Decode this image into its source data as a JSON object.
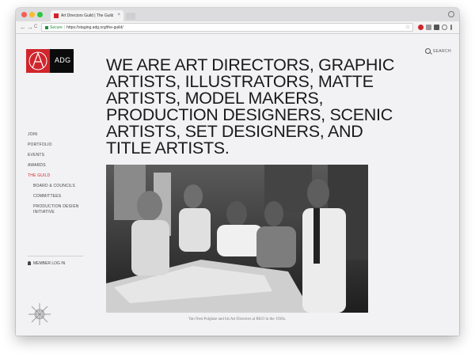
{
  "browser": {
    "tab_title": "Art Directors Guild | The Guild",
    "tab_close": "×",
    "url_secure_label": "Secure",
    "url_separator": "|",
    "url": "https://staging.adg.org/the-guild/",
    "back_glyph": "←",
    "forward_glyph": "→",
    "reload_glyph": "C",
    "bookmark_glyph": "☆"
  },
  "header": {
    "logo_text": "ADG",
    "search_label": "SEARCH"
  },
  "headline": "WE ARE ART DIRECTORS, GRAPHIC ARTISTS, ILLUSTRATORS, MATTE ARTISTS, MODEL MAKERS, PRODUCTION DESIGNERS, SCENIC ARTISTS, SET DESIGNERS, AND TITLE ARTISTS.",
  "sidebar": {
    "items": [
      {
        "label": "JOIN"
      },
      {
        "label": "PORTFOLIO"
      },
      {
        "label": "EVENTS"
      },
      {
        "label": "AWARDS"
      },
      {
        "label": "THE GUILD"
      }
    ],
    "sub_items": [
      {
        "label": "BOARD & COUNCILS"
      },
      {
        "label": "COMMITTEES"
      },
      {
        "label": "PRODUCTION DESIGN"
      },
      {
        "label": "INITIATIVE"
      }
    ],
    "member_login": "MEMBER LOG IN"
  },
  "photo": {
    "caption": "Van Nest Polglase and his Art Directors at RKO in the 1930s."
  },
  "colors": {
    "accent": "#d0252c",
    "page_bg": "#f2f2f4"
  },
  "icons": [
    "search-icon",
    "member-icon",
    "iatse-seal-icon",
    "adg-logo-icon"
  ]
}
